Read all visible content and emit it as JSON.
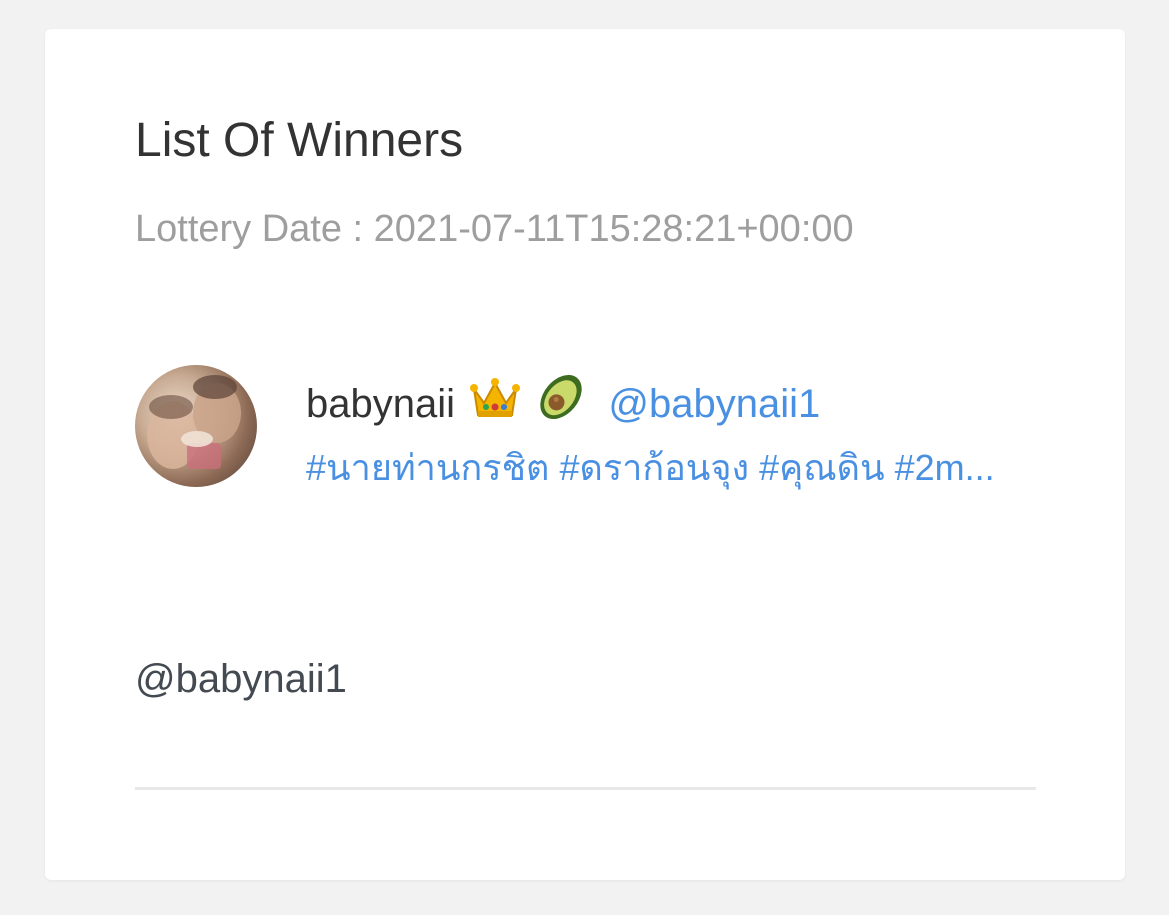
{
  "card": {
    "title": "List Of Winners",
    "lottery_date": "Lottery Date : 2021-07-11T15:28:21+00:00"
  },
  "winners": [
    {
      "display_name": "babynaii",
      "emojis": [
        "crown-emoji",
        "avocado-emoji"
      ],
      "handle": "@babynaii1",
      "hashtags": "#นายท่านกรชิต #ดราก้อนจุง #คุณดิน #2m..."
    }
  ],
  "footer": {
    "handle": "@babynaii1"
  },
  "colors": {
    "background": "#f2f2f2",
    "card": "#ffffff",
    "title": "#333333",
    "muted": "#9e9e9e",
    "link": "#4a90e2",
    "divider": "#e8e8e8"
  }
}
